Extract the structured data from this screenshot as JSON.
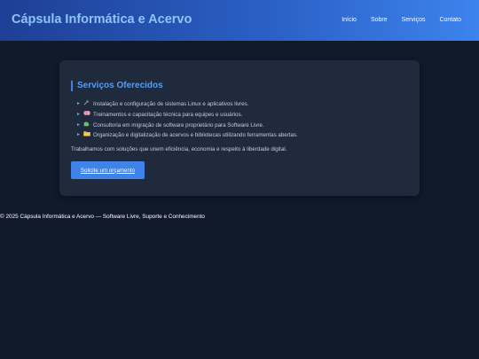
{
  "header": {
    "site_title": "Cápsula Informática e Acervo",
    "nav": [
      "Início",
      "Sobre",
      "Serviços",
      "Contato"
    ]
  },
  "services": {
    "title": "Serviços Oferecidos",
    "items": [
      {
        "icon": "wrench-icon",
        "text": "Instalação e configuração de sistemas Linux e aplicativos livres."
      },
      {
        "icon": "brain-icon",
        "text": "Treinamentos e capacitação técnica para equipes e usuários."
      },
      {
        "icon": "puzzle-icon",
        "text": "Consultoria em migração de software proprietário para Software Livre."
      },
      {
        "icon": "folder-icon",
        "text": "Organização e digitalização de acervos e bibliotecas utilizando ferramentas abertas."
      }
    ],
    "tagline": "Trabalhamos com soluções que unem eficiência, economia e respeito à liberdade digital.",
    "cta_label": "Solicite um orçamento"
  },
  "footer": {
    "text": "© 2025 Cápsula Informática e Acervo — Software Livre, Suporte e Conhecimento"
  },
  "colors": {
    "background": "#111a2b",
    "card": "#1f2a3c",
    "accent": "#3f82e8",
    "title_blue": "#5b9bf0"
  }
}
